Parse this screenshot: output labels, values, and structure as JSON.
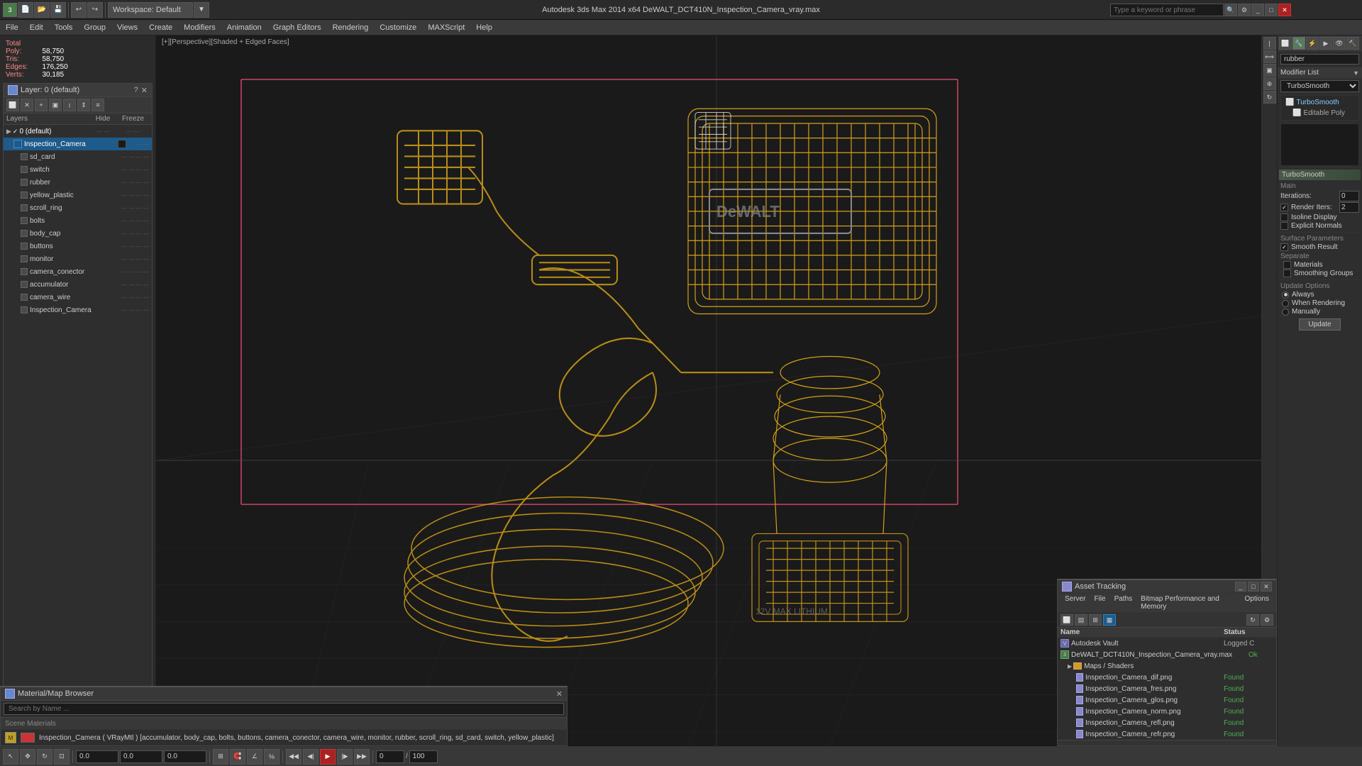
{
  "window": {
    "title": "Autodesk 3ds Max 2014 x64    DeWALT_DCT410N_Inspection_Camera_vray.max"
  },
  "toolbar": {
    "workspace_label": "Workspace: Default"
  },
  "menu": {
    "items": [
      "File",
      "Edit",
      "Tools",
      "Group",
      "Views",
      "Create",
      "Modifiers",
      "Animation",
      "Graph Editors",
      "Rendering",
      "Customize",
      "MAXScript",
      "Help"
    ]
  },
  "viewport": {
    "label": "[+][Perspective][Shaded + Edged Faces]"
  },
  "stats": {
    "total_label": "Total",
    "poly_label": "Poly:",
    "poly_value": "58,750",
    "tris_label": "Tris:",
    "tris_value": "58,750",
    "edges_label": "Edges:",
    "edges_value": "176,250",
    "verts_label": "Verts:",
    "verts_value": "30,185"
  },
  "layer_panel": {
    "title": "Layer: 0 (default)",
    "cols": {
      "name": "Layers",
      "hide": "Hide",
      "freeze": "Freeze"
    },
    "layers": [
      {
        "name": "0 (default)",
        "level": 0,
        "has_check": true,
        "is_default": true
      },
      {
        "name": "Inspection_Camera",
        "level": 1,
        "selected": true
      },
      {
        "name": "sd_card",
        "level": 2
      },
      {
        "name": "switch",
        "level": 2
      },
      {
        "name": "rubber",
        "level": 2
      },
      {
        "name": "yellow_plastic",
        "level": 2
      },
      {
        "name": "scroll_ring",
        "level": 2
      },
      {
        "name": "bolts",
        "level": 2
      },
      {
        "name": "body_cap",
        "level": 2
      },
      {
        "name": "buttons",
        "level": 2
      },
      {
        "name": "monitor",
        "level": 2
      },
      {
        "name": "camera_conector",
        "level": 2
      },
      {
        "name": "accumulator",
        "level": 2
      },
      {
        "name": "camera_wire",
        "level": 2
      },
      {
        "name": "Inspection_Camera",
        "level": 2
      }
    ]
  },
  "right_panel": {
    "rubber_input": "rubber",
    "modifier_list_label": "Modifier List",
    "modifiers": [
      {
        "name": "TurboSmooth",
        "active": true
      },
      {
        "name": "Editable Poly",
        "active": false,
        "sub": true
      }
    ]
  },
  "turbosmooth": {
    "title": "TurboSmooth",
    "main_label": "Main",
    "iterations_label": "Iterations:",
    "iterations_value": "0",
    "render_iters_label": "Render Iters:",
    "render_iters_value": "2",
    "isoline_display_label": "Isoline Display",
    "explicit_normals_label": "Explicit Normals",
    "surface_params_label": "Surface Parameters",
    "smooth_result_label": "Smooth Result",
    "smooth_result_checked": true,
    "separate_label": "Separate",
    "materials_label": "Materials",
    "smoothing_groups_label": "Smoothing Groups",
    "update_options_label": "Update Options",
    "always_label": "Always",
    "when_rendering_label": "When Rendering",
    "manually_label": "Manually",
    "update_btn": "Update"
  },
  "material_browser": {
    "title": "Material/Map Browser",
    "search_placeholder": "Search by Name ...",
    "scene_materials_label": "Scene Materials",
    "material_name": "Inspection_Camera ( VRayMtl ) [accumulator, body_cap, bolts, buttons, camera_conector, camera_wire, monitor, rubber, scroll_ring, sd_card, switch, yellow_plastic]",
    "material_icon_label": "M"
  },
  "asset_tracking": {
    "title": "Asset Tracking",
    "menu": [
      "Server",
      "File",
      "Paths",
      "Bitmap Performance and Memory",
      "Options"
    ],
    "cols": {
      "name": "Name",
      "status": "Status"
    },
    "assets": [
      {
        "name": "Autodesk Vault",
        "level": 0,
        "status": "Logged C",
        "status_type": "logged"
      },
      {
        "name": "DeWALT_DCT410N_Inspection_Camera_vray.max",
        "level": 0,
        "status": "Ok",
        "status_type": "ok"
      },
      {
        "name": "Maps / Shaders",
        "level": 1,
        "status": "",
        "is_folder": true
      },
      {
        "name": "Inspection_Camera_dif.png",
        "level": 2,
        "status": "Found",
        "status_type": "found"
      },
      {
        "name": "Inspection_Camera_fres.png",
        "level": 2,
        "status": "Found",
        "status_type": "found"
      },
      {
        "name": "Inspection_Camera_glos.png",
        "level": 2,
        "status": "Found",
        "status_type": "found"
      },
      {
        "name": "Inspection_Camera_norm.png",
        "level": 2,
        "status": "Found",
        "status_type": "found"
      },
      {
        "name": "Inspection_Camera_refl.png",
        "level": 2,
        "status": "Found",
        "status_type": "found"
      },
      {
        "name": "Inspection_Camera_refr.png",
        "level": 2,
        "status": "Found",
        "status_type": "found"
      }
    ]
  },
  "search": {
    "placeholder": "Type a keyword or phrase"
  },
  "colors": {
    "accent_blue": "#1e5a8a",
    "accent_yellow": "#d4a017",
    "grid": "#3a3a3a",
    "pink": "#cc4466"
  }
}
